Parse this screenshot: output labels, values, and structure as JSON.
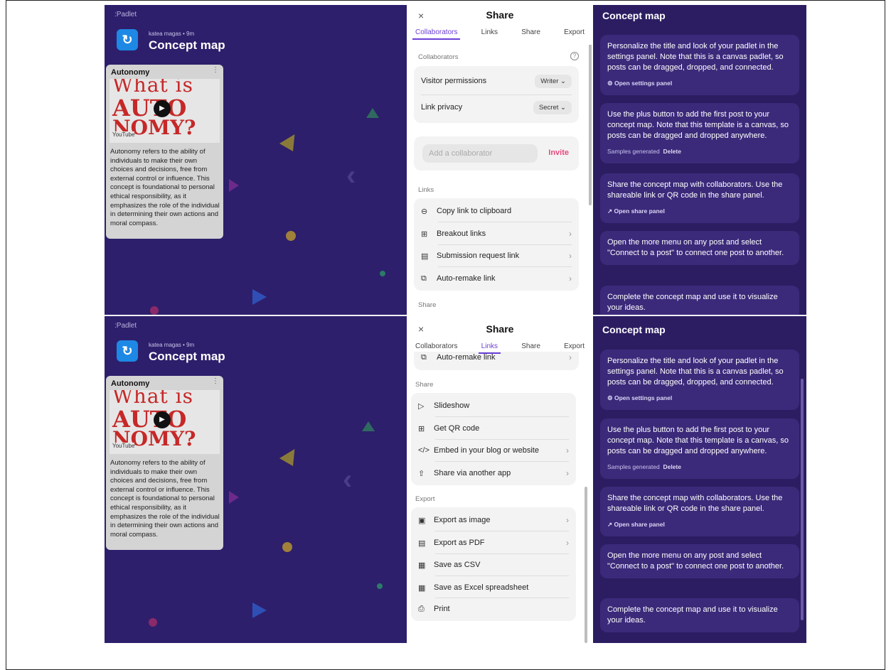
{
  "padlet": {
    "brand": ":Padlet",
    "meta": "katea magas • 9m",
    "title": "Concept map",
    "post": {
      "title": "Autonomy",
      "thumb_lines": [
        "What is",
        "AUTO",
        "NOMY?"
      ],
      "youtube": "YouTube",
      "body": "Autonomy refers to the ability of individuals to make their own choices and decisions, free from external control or influence. This concept is foundational to personal ethical responsibility, as it emphasizes the role of the individual in determining their own actions and moral compass."
    }
  },
  "share": {
    "title": "Share",
    "close": "×",
    "tabs": [
      "Collaborators",
      "Links",
      "Share",
      "Export"
    ],
    "collaborators_label": "Collaborators",
    "help": "?",
    "visitor_permissions": {
      "label": "Visitor permissions",
      "value": "Writer ⌄"
    },
    "link_privacy": {
      "label": "Link privacy",
      "value": "Secret ⌄"
    },
    "add_placeholder": "Add a collaborator",
    "invite": "Invite",
    "links_label": "Links",
    "links": [
      "Copy link to clipboard",
      "Breakout links",
      "Submission request link",
      "Auto-remake link"
    ],
    "share_label": "Share",
    "share_items": [
      "Slideshow",
      "Get QR code",
      "Embed in your blog or website",
      "Share via another app"
    ],
    "export_label": "Export",
    "export_items": [
      "Export as image",
      "Export as PDF",
      "Save as CSV",
      "Save as Excel spreadsheet",
      "Print"
    ],
    "partial_top": "Auto-remake link"
  },
  "info": {
    "title": "Concept map",
    "cards": [
      {
        "text": "Personalize the title and look of your padlet in the settings panel. Note that this is a canvas padlet, so posts can be dragged, dropped, and connected.",
        "action": "⚙ Open settings panel"
      },
      {
        "text": "Use the plus button to add the first post to your concept map. Note that this template is a canvas, so posts can be dragged and dropped anywhere.",
        "sub": "Samples generated",
        "action": "Delete"
      },
      {
        "text": "Share the concept map with collaborators. Use the shareable link or QR code in the share panel.",
        "action": "↗ Open share panel"
      },
      {
        "text": "Open the more menu on any post and select \"Connect to a post\" to connect one post to another."
      },
      {
        "text": "Complete the concept map and use it to visualize your ideas."
      }
    ]
  },
  "colors": {
    "canvas": "#2d1f6b",
    "accent": "#6b3fd6",
    "invite": "#e84a7b",
    "info_bg": "#2c1d62",
    "info_card": "#3b2a7a"
  }
}
